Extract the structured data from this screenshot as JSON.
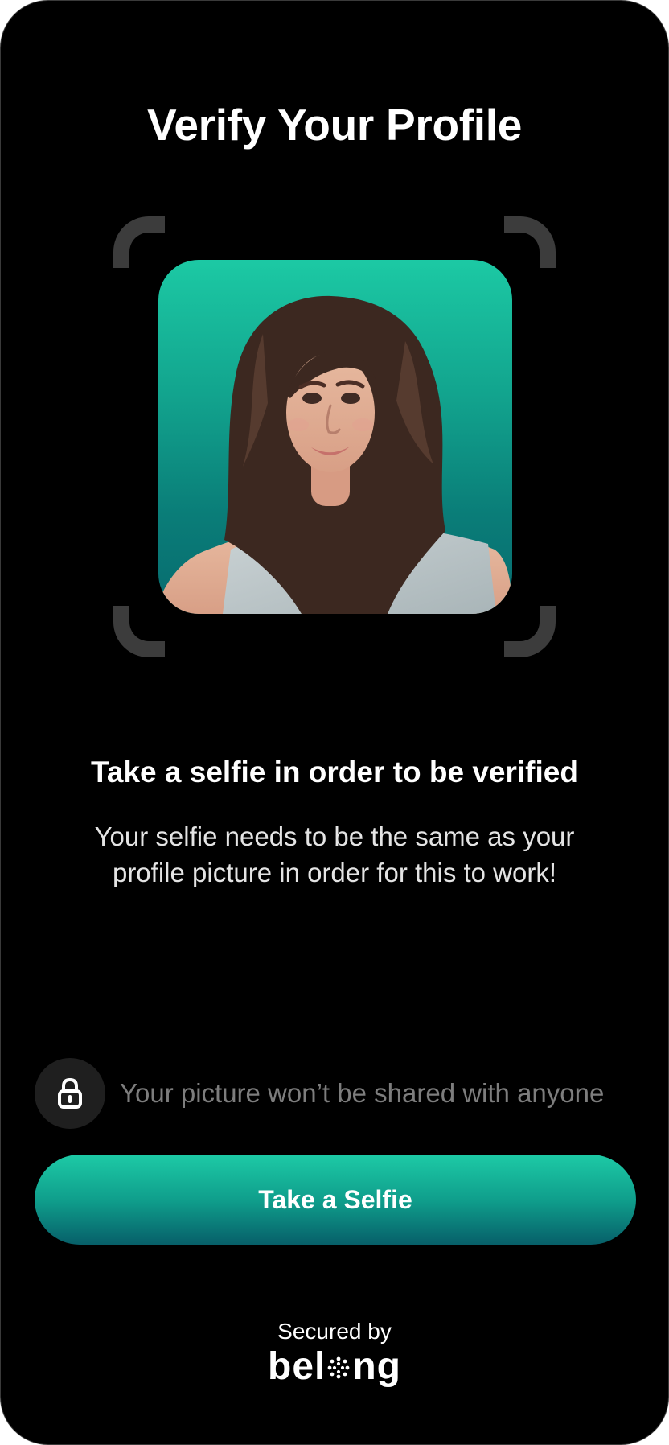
{
  "header": {
    "title": "Verify Your Profile"
  },
  "camera_frame": {
    "corner_color": "#3c3c3c",
    "photo_background_top": "#1cc9a4",
    "photo_background_bottom": "#076b6f"
  },
  "content": {
    "subtitle": "Take a selfie in order to be verified",
    "description": "Your selfie needs to be the same as your profile picture in order for this to work!"
  },
  "privacy": {
    "icon": "lock-icon",
    "text": "Your picture won’t be shared with anyone"
  },
  "actions": {
    "take_selfie_label": "Take a Selfie",
    "button_gradient_top": "#1dcaa6",
    "button_gradient_bottom": "#075f69"
  },
  "footer": {
    "secured_by": "Secured by",
    "brand_prefix": "bel",
    "brand_suffix": "ng",
    "brand_logo_icon": "belong-logo-icon"
  },
  "colors": {
    "background": "#000000",
    "primary_text": "#ffffff",
    "secondary_text": "#e4e4e4",
    "muted_text": "#7d7d7d",
    "lock_circle": "#1f1f1f"
  }
}
